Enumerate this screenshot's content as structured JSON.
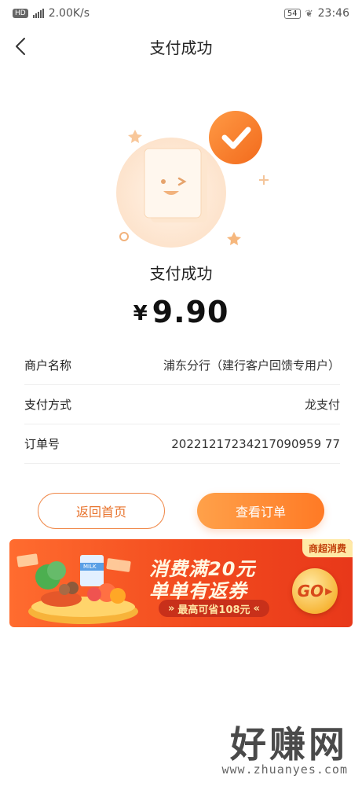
{
  "status_bar": {
    "hd": "HD",
    "network": "4G",
    "speed": "2.00K/s",
    "battery": "54",
    "time": "23:46"
  },
  "nav": {
    "back_icon": "chevron-left-icon",
    "title": "支付成功"
  },
  "result": {
    "title": "支付成功",
    "currency": "¥",
    "amount": "9.90"
  },
  "details": [
    {
      "label": "商户名称",
      "value": "浦东分行（建行客户回馈专用户）"
    },
    {
      "label": "支付方式",
      "value": "龙支付"
    },
    {
      "label": "订单号",
      "value": "20221217234217090959 77"
    }
  ],
  "buttons": {
    "home": "返回首页",
    "order": "查看订单"
  },
  "banner": {
    "tag": "商超消费",
    "line1": "消费满20元",
    "line2": "单单有返券",
    "pill": "最高可省108元",
    "go": "GO",
    "milk_label": "MILK"
  },
  "watermark": {
    "big": "好赚网",
    "small": "www.zhuanyes.com"
  },
  "colors": {
    "accent": "#ff7a25",
    "banner_red": "#f24a1e"
  }
}
